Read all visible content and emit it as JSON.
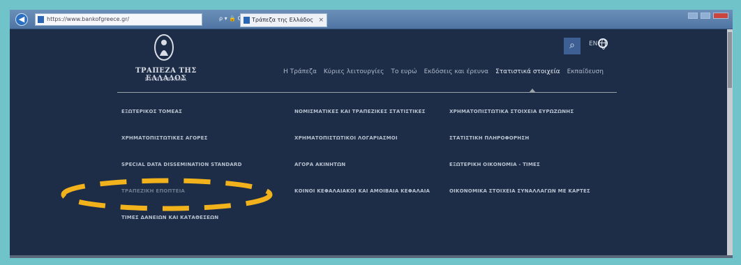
{
  "browser": {
    "address": "https://www.bankofgreece.gr/",
    "tab_title": "Τράπεζα της Ελλάδος",
    "addr_tools": "ρ ▾ 🔒 C",
    "tab_close": "×"
  },
  "header": {
    "bank_name": "ΤΡΑΠΕΖΑ ΤΗΣ ΕΛΛΑΔΟΣ",
    "eurosystem": "ΕΥΡΩΣΥΣΤΗΜΑ",
    "search_icon": "⌕",
    "language": "EN"
  },
  "mainnav": [
    {
      "label": "Η Τράπεζα"
    },
    {
      "label": "Κύριες λειτουργίες"
    },
    {
      "label": "Το ευρώ"
    },
    {
      "label": "Εκδόσεις και έρευνα"
    },
    {
      "label": "Στατιστικά στοιχεία"
    },
    {
      "label": "Εκπαίδευση"
    }
  ],
  "menu": {
    "col1": [
      {
        "label": "ΕΞΩΤΕΡΙΚΟΣ ΤΟΜΕΑΣ"
      },
      {
        "label": "ΧΡΗΜΑΤΟΠΙΣΤΩΤΙΚΕΣ ΑΓΟΡΕΣ"
      },
      {
        "label": "SPECIAL DATA DISSEMINATION STANDARD"
      },
      {
        "label": "ΤΡΑΠΕΖΙΚΗ ΕΠΟΠΤΕΙΑ"
      },
      {
        "label": "ΤΙΜΕΣ ΔΑΝΕΙΩΝ ΚΑΙ ΚΑΤΑΘΕΣΕΩΝ"
      }
    ],
    "col2": [
      {
        "label": "ΝΟΜΙΣΜΑΤΙΚΕΣ ΚΑΙ ΤΡΑΠΕΖΙΚΕΣ ΣΤΑΤΙΣΤΙΚΕΣ"
      },
      {
        "label": "ΧΡΗΜΑΤΟΠΙΣΤΩΤΙΚΟΙ ΛΟΓΑΡΙΑΣΜΟΙ"
      },
      {
        "label": "ΑΓΟΡΑ ΑΚΙΝΗΤΩΝ"
      },
      {
        "label": "ΚΟΙΝΟΙ ΚΕΦΑΛΑΙΑΚΟΙ ΚΑΙ ΑΜΟΙΒΑΙΑ ΚΕΦΑΛΑΙΑ"
      }
    ],
    "col3": [
      {
        "label": "ΧΡΗΜΑΤΟΠΙΣΤΩΤΙΚΑ ΣΤΟΙΧΕΙΑ ΕΥΡΩΖΩΝΗΣ"
      },
      {
        "label": "ΣΤΑΤΙΣΤΙΚΗ ΠΛΗΡΟΦΟΡΗΣΗ"
      },
      {
        "label": "ΕΞΩΤΕΡΙΚΗ ΟΙΚΟΝΟΜΙΑ - ΤΙΜΕΣ"
      },
      {
        "label": "ΟΙΚΟΝΟΜΙΚΑ ΣΤΟΙΧΕΙΑ ΣΥΝΑΛΛΑΓΩΝ ΜΕ ΚΑΡΤΕΣ"
      }
    ]
  },
  "colors": {
    "page_bg": "#1e2d47",
    "annotation": "#f2b21b",
    "browser_frame": "#6fc3c9"
  }
}
